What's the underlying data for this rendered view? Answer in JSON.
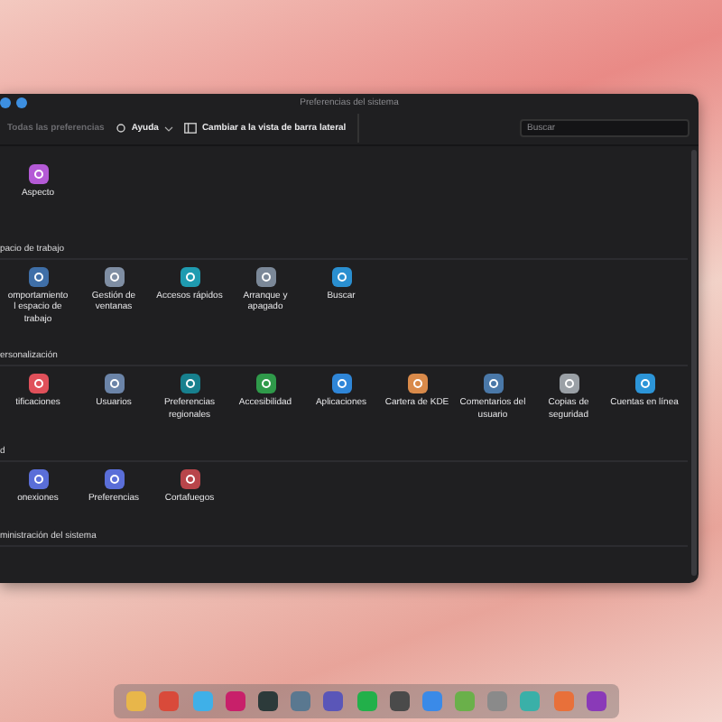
{
  "window": {
    "title": "Preferencias del sistema"
  },
  "toolbar": {
    "back": {
      "label": "Todas las preferencias",
      "disabled": true
    },
    "help": {
      "label": "Ayuda"
    },
    "switch_view": {
      "label": "Cambiar a la vista de barra lateral"
    },
    "search": {
      "placeholder": "Buscar"
    }
  },
  "sections": [
    {
      "items": [
        {
          "label": "Aspecto",
          "color": "#b45ad6"
        }
      ]
    },
    {
      "heading": "pacio de trabajo",
      "items": [
        {
          "label": "omportamiento\nl espacio de\ntrabajo",
          "color": "#3f6fa8"
        },
        {
          "label": "Gestión de\nventanas",
          "color": "#7f8ea3"
        },
        {
          "label": "Accesos rápidos",
          "color": "#1f9bb0"
        },
        {
          "label": "Arranque y\napagado",
          "color": "#7b8898"
        },
        {
          "label": "Buscar",
          "color": "#2a8fd0"
        }
      ]
    },
    {
      "heading": "ersonalización",
      "items": [
        {
          "label": "tificaciones",
          "color": "#e0505a"
        },
        {
          "label": "Usuarios",
          "color": "#6b84a8"
        },
        {
          "label": "Preferencias\nregionales",
          "color": "#17808e"
        },
        {
          "label": "Accesibilidad",
          "color": "#2f9a4a"
        },
        {
          "label": "Aplicaciones",
          "color": "#2f86d8"
        },
        {
          "label": "Cartera de KDE",
          "color": "#d98a4a"
        },
        {
          "label": "Comentarios del\nusuario",
          "color": "#4a78a8"
        },
        {
          "label": "Copias de\nseguridad",
          "color": "#9aa0a6"
        },
        {
          "label": "Cuentas en línea",
          "color": "#2c95d8"
        }
      ]
    },
    {
      "heading": "d",
      "items": [
        {
          "label": "onexiones",
          "color": "#5a6ed8"
        },
        {
          "label": "Preferencias",
          "color": "#5a6ed8"
        },
        {
          "label": "Cortafuegos",
          "color": "#b8454a"
        }
      ]
    },
    {
      "heading": "ministración del sistema"
    }
  ],
  "dock": [
    {
      "color": "#e8b64a"
    },
    {
      "color": "#d94a3a"
    },
    {
      "color": "#3fb0e8"
    },
    {
      "color": "#c8206a"
    },
    {
      "color": "#2c3a3a"
    },
    {
      "color": "#5a7890"
    },
    {
      "color": "#5a56b8"
    },
    {
      "color": "#22b04a"
    },
    {
      "color": "#4a4a4a"
    },
    {
      "color": "#3a8ae8"
    },
    {
      "color": "#6ab04a"
    },
    {
      "color": "#8a8a8a"
    },
    {
      "color": "#3ab0a8"
    },
    {
      "color": "#e8703a"
    },
    {
      "color": "#8a3ab8"
    }
  ]
}
